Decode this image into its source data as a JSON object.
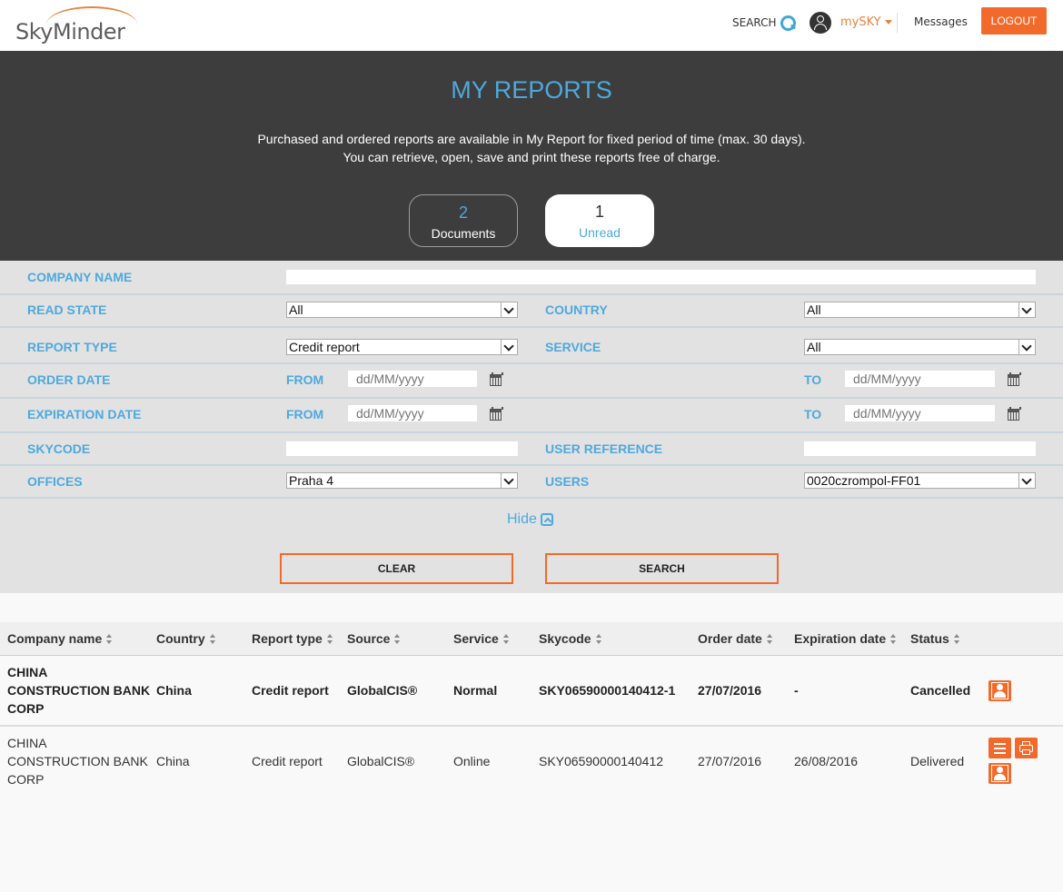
{
  "header": {
    "logo_text": "SkyMinder",
    "search_label": "SEARCH",
    "account_label": "mySKY",
    "messages_label": "Messages",
    "logout_label": "LOGOUT"
  },
  "hero": {
    "title": "MY REPORTS",
    "line1": "Purchased and ordered reports are available in My Report for fixed period of time (max. 30 days).",
    "line2": "You can retrieve, open, save and print these reports free of charge.",
    "documents_count": "2",
    "documents_label": "Documents",
    "unread_count": "1",
    "unread_label": "Unread"
  },
  "filters": {
    "company_name": {
      "label": "COMPANY NAME",
      "value": ""
    },
    "read_state": {
      "label": "READ STATE",
      "value": "All"
    },
    "country": {
      "label": "COUNTRY",
      "value": "All"
    },
    "report_type": {
      "label": "REPORT TYPE",
      "value": "Credit report"
    },
    "service": {
      "label": "SERVICE",
      "value": "All"
    },
    "order_date": {
      "label": "ORDER DATE",
      "from_label": "FROM",
      "to_label": "TO",
      "placeholder": "dd/MM/yyyy"
    },
    "expiration_date": {
      "label": "EXPIRATION DATE",
      "from_label": "FROM",
      "to_label": "TO",
      "placeholder": "dd/MM/yyyy"
    },
    "skycode": {
      "label": "SKYCODE",
      "value": ""
    },
    "user_reference": {
      "label": "USER REFERENCE",
      "value": ""
    },
    "offices": {
      "label": "OFFICES",
      "value": "Praha 4"
    },
    "users": {
      "label": "USERS",
      "value": "0020czrompol-FF01"
    },
    "hide_label": "Hide",
    "clear_label": "CLEAR",
    "search_label": "SEARCH"
  },
  "table": {
    "columns": [
      "Company name",
      "Country",
      "Report type",
      "Source",
      "Service",
      "Skycode",
      "Order date",
      "Expiration date",
      "Status"
    ],
    "rows": [
      {
        "company": [
          "CHINA",
          "CONSTRUCTION BANK",
          "CORP"
        ],
        "country": "China",
        "report_type": "Credit report",
        "source": "GlobalCIS®",
        "service": "Normal",
        "skycode": "SKY06590000140412-1",
        "order_date": "27/07/2016",
        "expiration_date": "-",
        "status": "Cancelled"
      },
      {
        "company": [
          "CHINA",
          "CONSTRUCTION BANK",
          "CORP"
        ],
        "country": "China",
        "report_type": "Credit report",
        "source": "GlobalCIS®",
        "service": "Online",
        "skycode": "SKY06590000140412",
        "order_date": "27/07/2016",
        "expiration_date": "26/08/2016",
        "status": "Delivered"
      }
    ]
  },
  "colors": {
    "accent_orange": "#f26a2b",
    "accent_blue": "#4da9dd",
    "hero_bg": "#3d3d3d",
    "filter_bg": "#e2e2e2"
  },
  "icons": [
    "search-icon",
    "user-icon",
    "calendar-icon",
    "collapse-icon",
    "sort-icon",
    "contact-icon",
    "list-icon",
    "print-icon"
  ]
}
